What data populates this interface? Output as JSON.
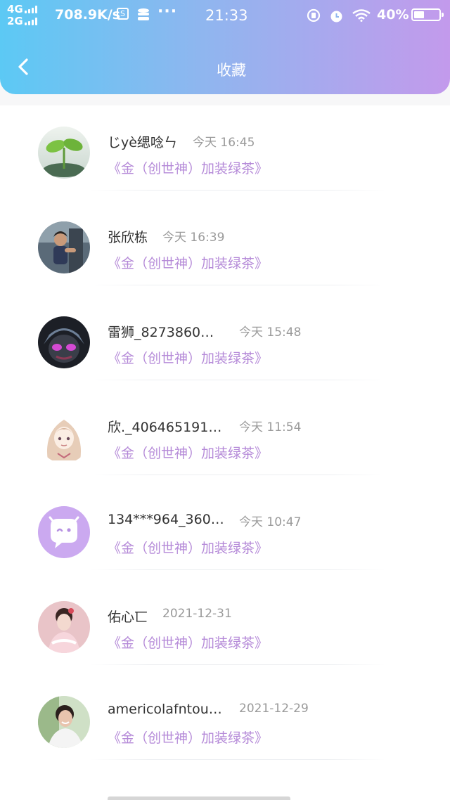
{
  "status_bar": {
    "network_1": "4G",
    "network_2": "2G",
    "speed": "708.9K/s",
    "time": "21:33",
    "battery": "40%",
    "battery_level": 0.4
  },
  "header": {
    "title": "收藏",
    "back_icon": "chevron-left-icon"
  },
  "items": [
    {
      "name": "じyè缌唸ㄣ",
      "time": "今天 16:45",
      "link": "《金（创世神）加装绿茶》",
      "avatar": "sprout"
    },
    {
      "name": "张欣栋",
      "time": "今天 16:39",
      "link": "《金（创世神）加装绿茶》",
      "avatar": "child"
    },
    {
      "name": "雷狮_8273860…",
      "time": "今天 15:48",
      "link": "《金（创世神）加装绿茶》",
      "avatar": "anime-dark"
    },
    {
      "name": "欣._406465191…",
      "time": "今天 11:54",
      "link": "《金（创世神）加装绿茶》",
      "avatar": "anime-girl"
    },
    {
      "name": "134***964_360…",
      "time": "今天 10:47",
      "link": "《金（创世神）加装绿茶》",
      "avatar": "default-chat"
    },
    {
      "name": "佑心匸",
      "time": "2021-12-31",
      "link": "《金（创世神）加装绿茶》",
      "avatar": "girl-pink"
    },
    {
      "name": "americolafntou…",
      "time": "2021-12-29",
      "link": "《金（创世神）加装绿茶》",
      "avatar": "girl-smile"
    }
  ]
}
